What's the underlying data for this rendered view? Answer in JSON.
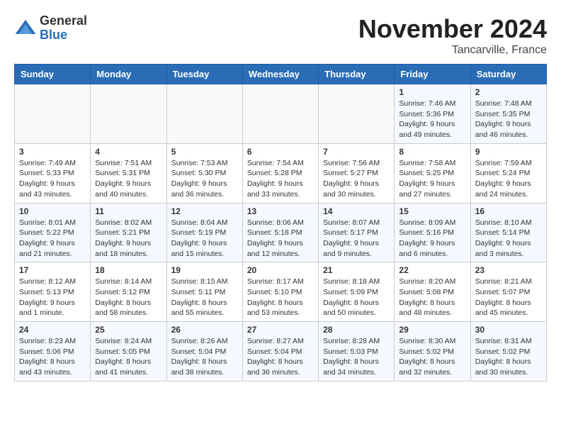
{
  "header": {
    "logo_general": "General",
    "logo_blue": "Blue",
    "month_title": "November 2024",
    "location": "Tancarville, France"
  },
  "days_of_week": [
    "Sunday",
    "Monday",
    "Tuesday",
    "Wednesday",
    "Thursday",
    "Friday",
    "Saturday"
  ],
  "weeks": [
    [
      {
        "day": "",
        "info": ""
      },
      {
        "day": "",
        "info": ""
      },
      {
        "day": "",
        "info": ""
      },
      {
        "day": "",
        "info": ""
      },
      {
        "day": "",
        "info": ""
      },
      {
        "day": "1",
        "info": "Sunrise: 7:46 AM\nSunset: 5:36 PM\nDaylight: 9 hours\nand 49 minutes."
      },
      {
        "day": "2",
        "info": "Sunrise: 7:48 AM\nSunset: 5:35 PM\nDaylight: 9 hours\nand 46 minutes."
      }
    ],
    [
      {
        "day": "3",
        "info": "Sunrise: 7:49 AM\nSunset: 5:33 PM\nDaylight: 9 hours\nand 43 minutes."
      },
      {
        "day": "4",
        "info": "Sunrise: 7:51 AM\nSunset: 5:31 PM\nDaylight: 9 hours\nand 40 minutes."
      },
      {
        "day": "5",
        "info": "Sunrise: 7:53 AM\nSunset: 5:30 PM\nDaylight: 9 hours\nand 36 minutes."
      },
      {
        "day": "6",
        "info": "Sunrise: 7:54 AM\nSunset: 5:28 PM\nDaylight: 9 hours\nand 33 minutes."
      },
      {
        "day": "7",
        "info": "Sunrise: 7:56 AM\nSunset: 5:27 PM\nDaylight: 9 hours\nand 30 minutes."
      },
      {
        "day": "8",
        "info": "Sunrise: 7:58 AM\nSunset: 5:25 PM\nDaylight: 9 hours\nand 27 minutes."
      },
      {
        "day": "9",
        "info": "Sunrise: 7:59 AM\nSunset: 5:24 PM\nDaylight: 9 hours\nand 24 minutes."
      }
    ],
    [
      {
        "day": "10",
        "info": "Sunrise: 8:01 AM\nSunset: 5:22 PM\nDaylight: 9 hours\nand 21 minutes."
      },
      {
        "day": "11",
        "info": "Sunrise: 8:02 AM\nSunset: 5:21 PM\nDaylight: 9 hours\nand 18 minutes."
      },
      {
        "day": "12",
        "info": "Sunrise: 8:04 AM\nSunset: 5:19 PM\nDaylight: 9 hours\nand 15 minutes."
      },
      {
        "day": "13",
        "info": "Sunrise: 8:06 AM\nSunset: 5:18 PM\nDaylight: 9 hours\nand 12 minutes."
      },
      {
        "day": "14",
        "info": "Sunrise: 8:07 AM\nSunset: 5:17 PM\nDaylight: 9 hours\nand 9 minutes."
      },
      {
        "day": "15",
        "info": "Sunrise: 8:09 AM\nSunset: 5:16 PM\nDaylight: 9 hours\nand 6 minutes."
      },
      {
        "day": "16",
        "info": "Sunrise: 8:10 AM\nSunset: 5:14 PM\nDaylight: 9 hours\nand 3 minutes."
      }
    ],
    [
      {
        "day": "17",
        "info": "Sunrise: 8:12 AM\nSunset: 5:13 PM\nDaylight: 9 hours\nand 1 minute."
      },
      {
        "day": "18",
        "info": "Sunrise: 8:14 AM\nSunset: 5:12 PM\nDaylight: 8 hours\nand 58 minutes."
      },
      {
        "day": "19",
        "info": "Sunrise: 8:15 AM\nSunset: 5:11 PM\nDaylight: 8 hours\nand 55 minutes."
      },
      {
        "day": "20",
        "info": "Sunrise: 8:17 AM\nSunset: 5:10 PM\nDaylight: 8 hours\nand 53 minutes."
      },
      {
        "day": "21",
        "info": "Sunrise: 8:18 AM\nSunset: 5:09 PM\nDaylight: 8 hours\nand 50 minutes."
      },
      {
        "day": "22",
        "info": "Sunrise: 8:20 AM\nSunset: 5:08 PM\nDaylight: 8 hours\nand 48 minutes."
      },
      {
        "day": "23",
        "info": "Sunrise: 8:21 AM\nSunset: 5:07 PM\nDaylight: 8 hours\nand 45 minutes."
      }
    ],
    [
      {
        "day": "24",
        "info": "Sunrise: 8:23 AM\nSunset: 5:06 PM\nDaylight: 8 hours\nand 43 minutes."
      },
      {
        "day": "25",
        "info": "Sunrise: 8:24 AM\nSunset: 5:05 PM\nDaylight: 8 hours\nand 41 minutes."
      },
      {
        "day": "26",
        "info": "Sunrise: 8:26 AM\nSunset: 5:04 PM\nDaylight: 8 hours\nand 38 minutes."
      },
      {
        "day": "27",
        "info": "Sunrise: 8:27 AM\nSunset: 5:04 PM\nDaylight: 8 hours\nand 36 minutes."
      },
      {
        "day": "28",
        "info": "Sunrise: 8:28 AM\nSunset: 5:03 PM\nDaylight: 8 hours\nand 34 minutes."
      },
      {
        "day": "29",
        "info": "Sunrise: 8:30 AM\nSunset: 5:02 PM\nDaylight: 8 hours\nand 32 minutes."
      },
      {
        "day": "30",
        "info": "Sunrise: 8:31 AM\nSunset: 5:02 PM\nDaylight: 8 hours\nand 30 minutes."
      }
    ]
  ]
}
